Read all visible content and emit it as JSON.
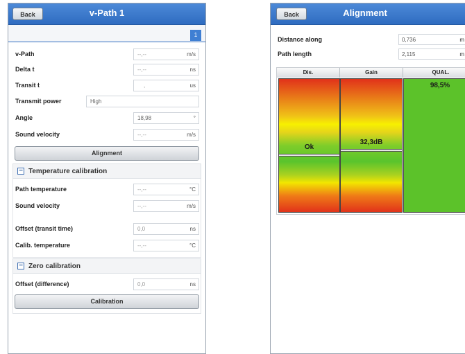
{
  "vpath": {
    "back_label": "Back",
    "title": "v-Path 1",
    "page_tab": "1",
    "rows": [
      {
        "label": "v-Path",
        "value": "--,--",
        "unit": "m/s"
      },
      {
        "label": "Delta t",
        "value": "--,--",
        "unit": "ns"
      },
      {
        "label": "Transit t",
        "value": ",",
        "unit": "us"
      }
    ],
    "transmit_power": {
      "label": "Transmit power",
      "value": "High"
    },
    "angle": {
      "label": "Angle",
      "value": "18,98",
      "unit": "°"
    },
    "sound_velocity": {
      "label": "Sound velocity",
      "value": "--,--",
      "unit": "m/s"
    },
    "alignment_button": "Alignment",
    "temperature_calibration": {
      "title": "Temperature calibration",
      "collapse_symbol": "−",
      "path_temperature": {
        "label": "Path temperature",
        "value": "--,--",
        "unit": "°C"
      },
      "sound_velocity": {
        "label": "Sound velocity",
        "value": "--,--",
        "unit": "m/s"
      },
      "offset": {
        "label": "Offset (transit time)",
        "value": "0,0",
        "unit": "ns"
      },
      "calib_temperature": {
        "label": "Calib. temperature",
        "value": "--,--",
        "unit": "°C"
      }
    },
    "zero_calibration": {
      "title": "Zero calibration",
      "collapse_symbol": "−",
      "offset_difference": {
        "label": "Offset (difference)",
        "value": "0,0",
        "unit": "ns"
      }
    },
    "calibration_button": "Calibration"
  },
  "alignment": {
    "back_label": "Back",
    "title": "Alignment",
    "distance_along": {
      "label": "Distance along",
      "value": "0,736",
      "unit": "m"
    },
    "path_length": {
      "label": "Path length",
      "value": "2,115",
      "unit": "m"
    },
    "columns": {
      "dis": "Dis.",
      "gain": "Gain",
      "qual": "QUAL."
    },
    "dis_value": "Ok",
    "gain_value": "32,3dB",
    "qual_value": "98,5%",
    "colors": {
      "header_blue": "#2f6cc0",
      "qual_green": "#5cc22a",
      "bad_red": "#e1321a",
      "warn_yellow": "#f7f000"
    }
  }
}
